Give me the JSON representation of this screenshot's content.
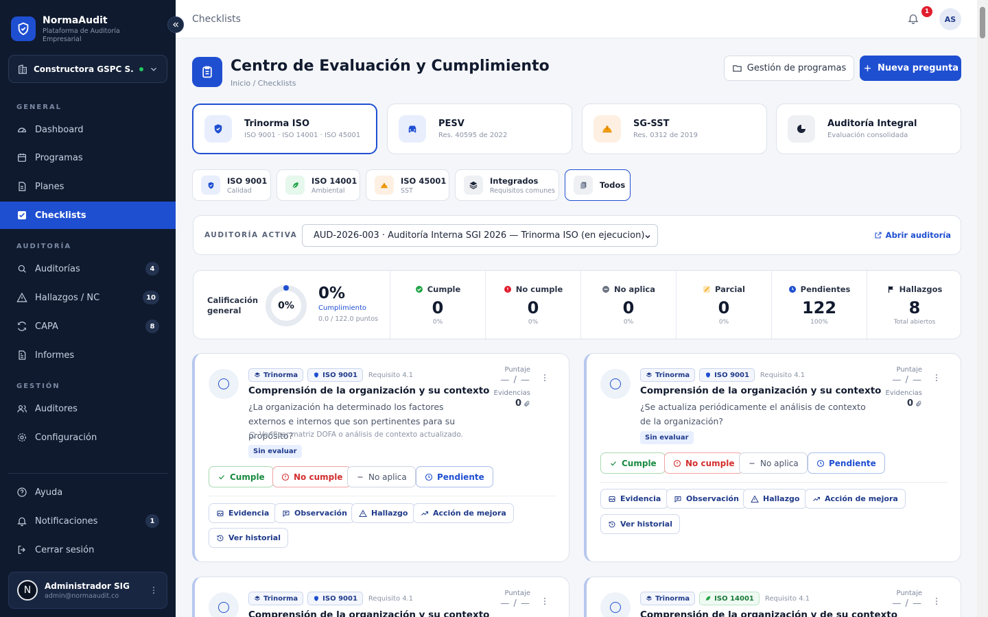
{
  "brand": {
    "name": "NormaAudit",
    "subtitle": "Plataforma de Auditoría Empresarial"
  },
  "org": {
    "name": "Constructora GSPC S.A...",
    "status_color": "#22c55e"
  },
  "sidebar": {
    "sections": {
      "general": "GENERAL",
      "auditoria": "AUDITORÍA",
      "gestion": "GESTIÓN"
    },
    "items": [
      {
        "label": "Dashboard",
        "icon": "gauge-icon"
      },
      {
        "label": "Programas",
        "icon": "calendar-icon"
      },
      {
        "label": "Planes",
        "icon": "document-icon"
      },
      {
        "label": "Checklists",
        "icon": "checkbox-icon",
        "active": true
      },
      {
        "label": "Auditorías",
        "icon": "search-icon",
        "badge": "4"
      },
      {
        "label": "Hallazgos / NC",
        "icon": "warning-icon",
        "badge": "10"
      },
      {
        "label": "CAPA",
        "icon": "refresh-icon",
        "badge": "8"
      },
      {
        "label": "Informes",
        "icon": "report-icon"
      },
      {
        "label": "Auditores",
        "icon": "users-icon"
      },
      {
        "label": "Configuración",
        "icon": "gear-icon"
      },
      {
        "label": "Ayuda",
        "icon": "help-icon"
      },
      {
        "label": "Notificaciones",
        "icon": "bell-icon",
        "badge": "1"
      },
      {
        "label": "Cerrar sesión",
        "icon": "logout-icon"
      }
    ],
    "user": {
      "initial": "N",
      "name": "Administrador SIG",
      "email": "admin@normaaudit.co"
    }
  },
  "topbar": {
    "title": "Checklists",
    "notif_count": "1",
    "avatar": "AS"
  },
  "header": {
    "title": "Centro de Evaluación y Cumplimiento",
    "breadcrumb": "Inicio / Checklists",
    "btn_programs": "Gestión de programas",
    "btn_new": "Nueva pregunta"
  },
  "programs": [
    {
      "title": "Trinorma ISO",
      "sub": "ISO 9001 · ISO 14001 · ISO 45001",
      "active": true
    },
    {
      "title": "PESV",
      "sub": "Res. 40595 de 2022"
    },
    {
      "title": "SG-SST",
      "sub": "Res. 0312 de 2019"
    },
    {
      "title": "Auditoría Integral",
      "sub": "Evaluación consolidada"
    }
  ],
  "norms": [
    {
      "title": "ISO 9001",
      "sub": "Calidad"
    },
    {
      "title": "ISO 14001",
      "sub": "Ambiental"
    },
    {
      "title": "ISO 45001",
      "sub": "SST"
    },
    {
      "title": "Integrados",
      "sub": "Requisitos comunes"
    },
    {
      "title": "Todos",
      "active": true
    }
  ],
  "audit": {
    "label": "AUDITORÍA ACTIVA",
    "selected": "AUD-2026-003 · Auditoría Interna SGI 2026 — Trinorma ISO (en ejecucion)",
    "open_link": "Abrir auditoría"
  },
  "stats": {
    "grade_label": "Calificación general",
    "grade_value": 0,
    "donut_text": "0%",
    "pct": "0%",
    "pct_label": "Cumplimiento",
    "points": "0.0 / 122.0 puntos",
    "items": [
      {
        "label": "Cumple",
        "value": "0",
        "pct": "0%",
        "color": "#22a447"
      },
      {
        "label": "No cumple",
        "value": "0",
        "pct": "0%",
        "color": "#e11d2e"
      },
      {
        "label": "No aplica",
        "value": "0",
        "pct": "0%",
        "color": "#6b7280"
      },
      {
        "label": "Parcial",
        "value": "0",
        "pct": "0%",
        "color": "#f59e0b"
      },
      {
        "label": "Pendientes",
        "value": "122",
        "pct": "100%",
        "color": "#1f4fd1"
      },
      {
        "label": "Hallazgos",
        "value": "8",
        "pct": "Total abiertos",
        "color": "#111a2e"
      }
    ]
  },
  "question_labels": {
    "score": "Puntaje",
    "score_value": "— / —",
    "evidence": "Evidencias",
    "status": "Sin evaluar",
    "cumple": "Cumple",
    "no_cumple": "No cumple",
    "no_aplica": "No aplica",
    "pendiente": "Pendiente",
    "evidencia": "Evidencia",
    "observacion": "Observación",
    "hallazgo": "Hallazgo",
    "accion": "Acción de mejora",
    "historial": "Ver historial"
  },
  "questions": [
    {
      "program_tag": "Trinorma",
      "norm_tag": "ISO 9001",
      "requirement": "Requisito 4.1",
      "title": "Comprensión de la organización y su contexto",
      "text": "¿La organización ha determinado los factores externos e internos que son pertinentes para su propósito?",
      "hint": "Verificar matriz DOFA o análisis de contexto actualizado.",
      "evidence_count": "0"
    },
    {
      "program_tag": "Trinorma",
      "norm_tag": "ISO 9001",
      "requirement": "Requisito 4.1",
      "title": "Comprensión de la organización y su contexto",
      "text": "¿Se actualiza periódicamente el análisis de contexto de la organización?",
      "evidence_count": "0"
    },
    {
      "program_tag": "Trinorma",
      "norm_tag": "ISO 9001",
      "requirement": "Requisito 4.1",
      "title": "Comprensión de la organización y su contexto"
    },
    {
      "program_tag": "Trinorma",
      "norm_tag": "ISO 14001",
      "requirement": "Requisito 4.1",
      "title": "Comprensión de la organización y de su contexto"
    }
  ]
}
